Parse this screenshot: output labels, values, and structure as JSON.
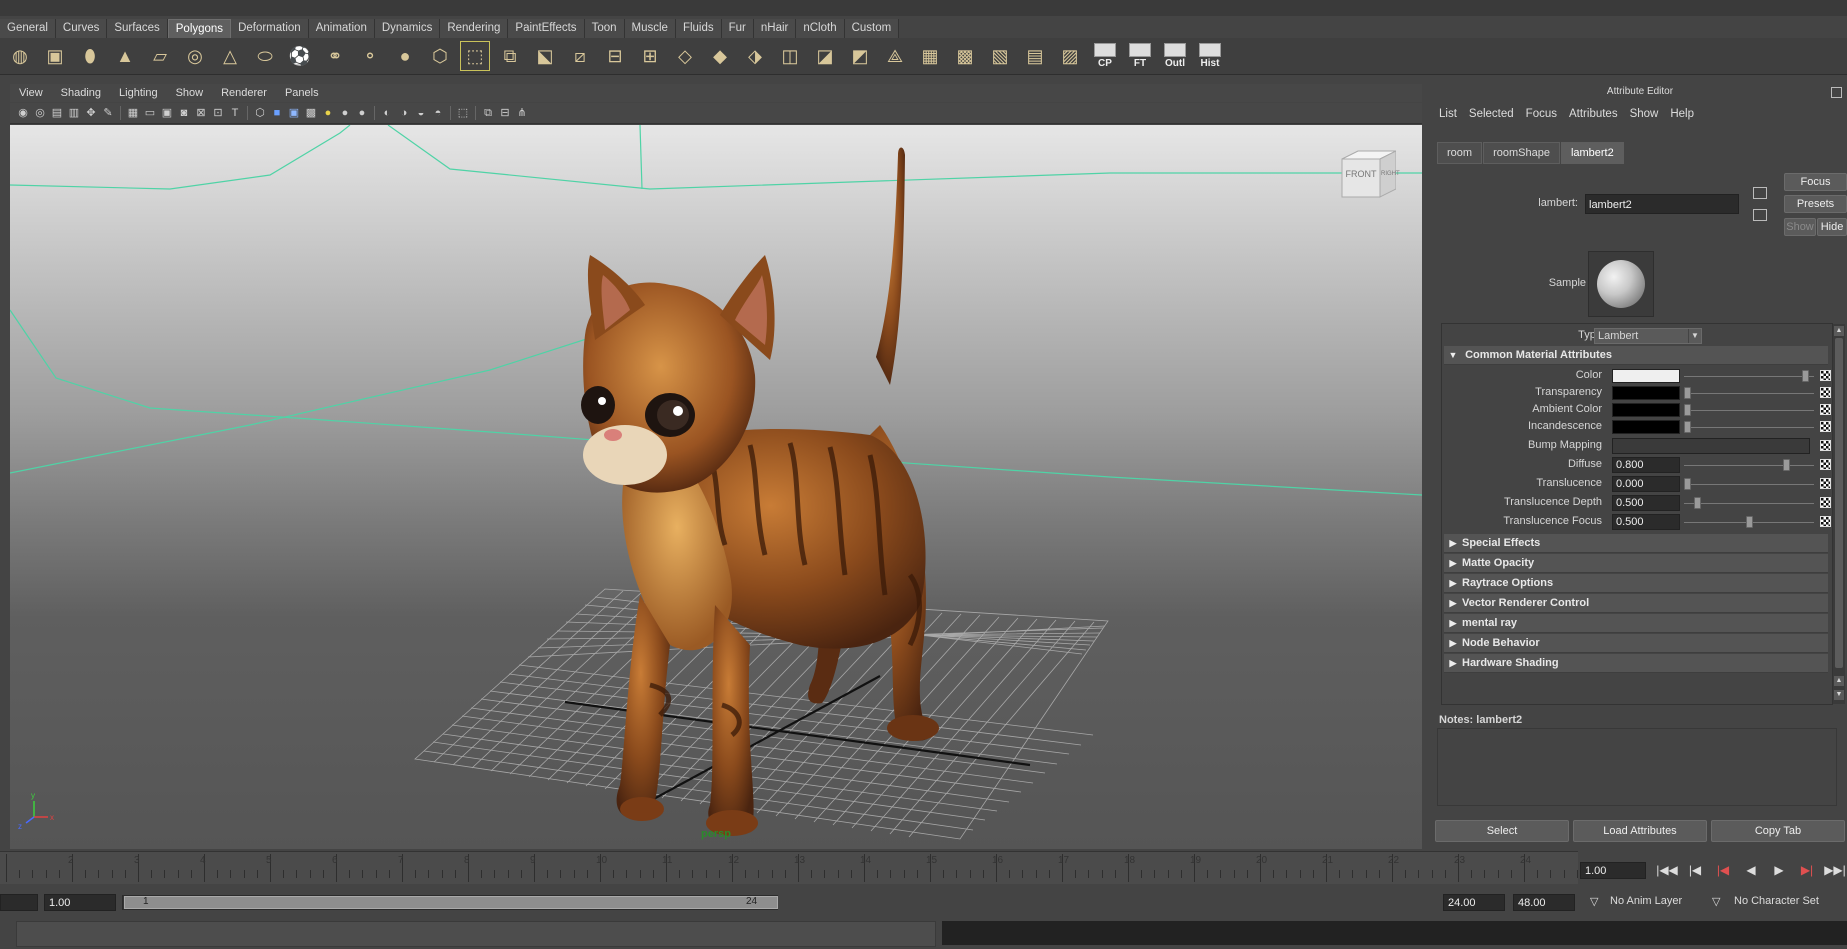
{
  "shelf_tabs": [
    "General",
    "Curves",
    "Surfaces",
    "Polygons",
    "Deformation",
    "Animation",
    "Dynamics",
    "Rendering",
    "PaintEffects",
    "Toon",
    "Muscle",
    "Fluids",
    "Fur",
    "nHair",
    "nCloth",
    "Custom"
  ],
  "active_shelf_tab": "Polygons",
  "shelf_icons": [
    {
      "name": "poly-sphere-icon",
      "glyph": "◍"
    },
    {
      "name": "poly-cube-icon",
      "glyph": "▣"
    },
    {
      "name": "poly-cylinder-icon",
      "glyph": "⬮"
    },
    {
      "name": "poly-cone-icon",
      "glyph": "▲"
    },
    {
      "name": "poly-plane-icon",
      "glyph": "▱"
    },
    {
      "name": "poly-torus-icon",
      "glyph": "◎"
    },
    {
      "name": "poly-pyramid-icon",
      "glyph": "△"
    },
    {
      "name": "poly-pipe-icon",
      "glyph": "⬭"
    },
    {
      "name": "poly-soccer-ball-icon",
      "glyph": "⚽"
    },
    {
      "name": "combine-icon",
      "glyph": "⚭"
    },
    {
      "name": "separate-icon",
      "glyph": "⚬"
    },
    {
      "name": "smooth-icon",
      "glyph": "●"
    },
    {
      "name": "platonic-icon",
      "glyph": "⬡"
    },
    {
      "name": "extrude-icon",
      "glyph": "⬚"
    },
    {
      "name": "bridge-icon",
      "glyph": "⧉"
    },
    {
      "name": "append-polygon-icon",
      "glyph": "⬕"
    },
    {
      "name": "split-polygon-icon",
      "glyph": "⧄"
    },
    {
      "name": "insert-edge-loop-icon",
      "glyph": "⊟"
    },
    {
      "name": "offset-edge-loop-icon",
      "glyph": "⊞"
    },
    {
      "name": "poke-face-icon",
      "glyph": "◇"
    },
    {
      "name": "wedge-face-icon",
      "glyph": "◆"
    },
    {
      "name": "merge-vertices-icon",
      "glyph": "⬗"
    },
    {
      "name": "duplicate-face-icon",
      "glyph": "◫"
    },
    {
      "name": "extract-icon",
      "glyph": "◪"
    },
    {
      "name": "mirror-icon",
      "glyph": "◩"
    },
    {
      "name": "sculpt-icon",
      "glyph": "⟁"
    },
    {
      "name": "planar-map-icon",
      "glyph": "▦"
    },
    {
      "name": "cylindrical-map-icon",
      "glyph": "▩"
    },
    {
      "name": "spherical-map-icon",
      "glyph": "▧"
    },
    {
      "name": "automatic-map-icon",
      "glyph": "▤"
    },
    {
      "name": "checker-map-icon",
      "glyph": "▨"
    }
  ],
  "shelf_text_icons": [
    "CP",
    "FT",
    "Outl",
    "Hist"
  ],
  "viewport_menu": [
    "View",
    "Shading",
    "Lighting",
    "Show",
    "Renderer",
    "Panels"
  ],
  "viewport_label": "persp",
  "viewcube": {
    "front": "FRONT",
    "right": "RIGHT"
  },
  "attribute_editor": {
    "title": "Attribute Editor",
    "menu": [
      "List",
      "Selected",
      "Focus",
      "Attributes",
      "Show",
      "Help"
    ],
    "tabs": [
      "room",
      "roomShape",
      "lambert2"
    ],
    "active_tab": "lambert2",
    "type_label": "lambert:",
    "node_name": "lambert2",
    "buttons": {
      "focus": "Focus",
      "presets": "Presets",
      "show": "Show",
      "hide": "Hide"
    },
    "sample_label": "Sample",
    "type_field_label": "Type",
    "type_value": "Lambert",
    "common_section": "Common Material Attributes",
    "attributes": [
      {
        "label": "Color",
        "kind": "swatch",
        "color": "#efefef",
        "slider": 0.95
      },
      {
        "label": "Transparency",
        "kind": "swatch",
        "color": "#000000",
        "slider": 0.0
      },
      {
        "label": "Ambient Color",
        "kind": "swatch",
        "color": "#000000",
        "slider": 0.0
      },
      {
        "label": "Incandescence",
        "kind": "swatch",
        "color": "#000000",
        "slider": 0.0
      },
      {
        "label": "Bump Mapping",
        "kind": "bump"
      },
      {
        "label": "Diffuse",
        "kind": "number",
        "value": "0.800",
        "slider": 0.8
      },
      {
        "label": "Translucence",
        "kind": "number",
        "value": "0.000",
        "slider": 0.0
      },
      {
        "label": "Translucence Depth",
        "kind": "number",
        "value": "0.500",
        "slider": 0.08
      },
      {
        "label": "Translucence Focus",
        "kind": "number",
        "value": "0.500",
        "slider": 0.5
      }
    ],
    "collapsed_sections": [
      "Special Effects",
      "Matte Opacity",
      "Raytrace Options",
      "Vector Renderer Control",
      "mental ray",
      "Node Behavior",
      "Hardware Shading"
    ],
    "notes_label": "Notes:  lambert2",
    "bottom_buttons": [
      "Select",
      "Load Attributes",
      "Copy Tab"
    ]
  },
  "timeline": {
    "ticks": [
      "2",
      "3",
      "4",
      "5",
      "6",
      "7",
      "8",
      "9",
      "10",
      "11",
      "12",
      "13",
      "14",
      "15",
      "16",
      "17",
      "18",
      "19",
      "20",
      "21",
      "22",
      "23",
      "24"
    ],
    "current_frame": "1.00"
  },
  "range": {
    "start_time": "1.00",
    "range_start": "1",
    "range_end": "24",
    "end_time": "24.00",
    "playback_end": "48.00",
    "anim_layer": "No Anim Layer",
    "character_set": "No Character Set"
  },
  "colors": {
    "accent_green": "#2b8a2b",
    "grid_line": "#4fd3a6",
    "cat_fur": "#8a4a1c"
  }
}
